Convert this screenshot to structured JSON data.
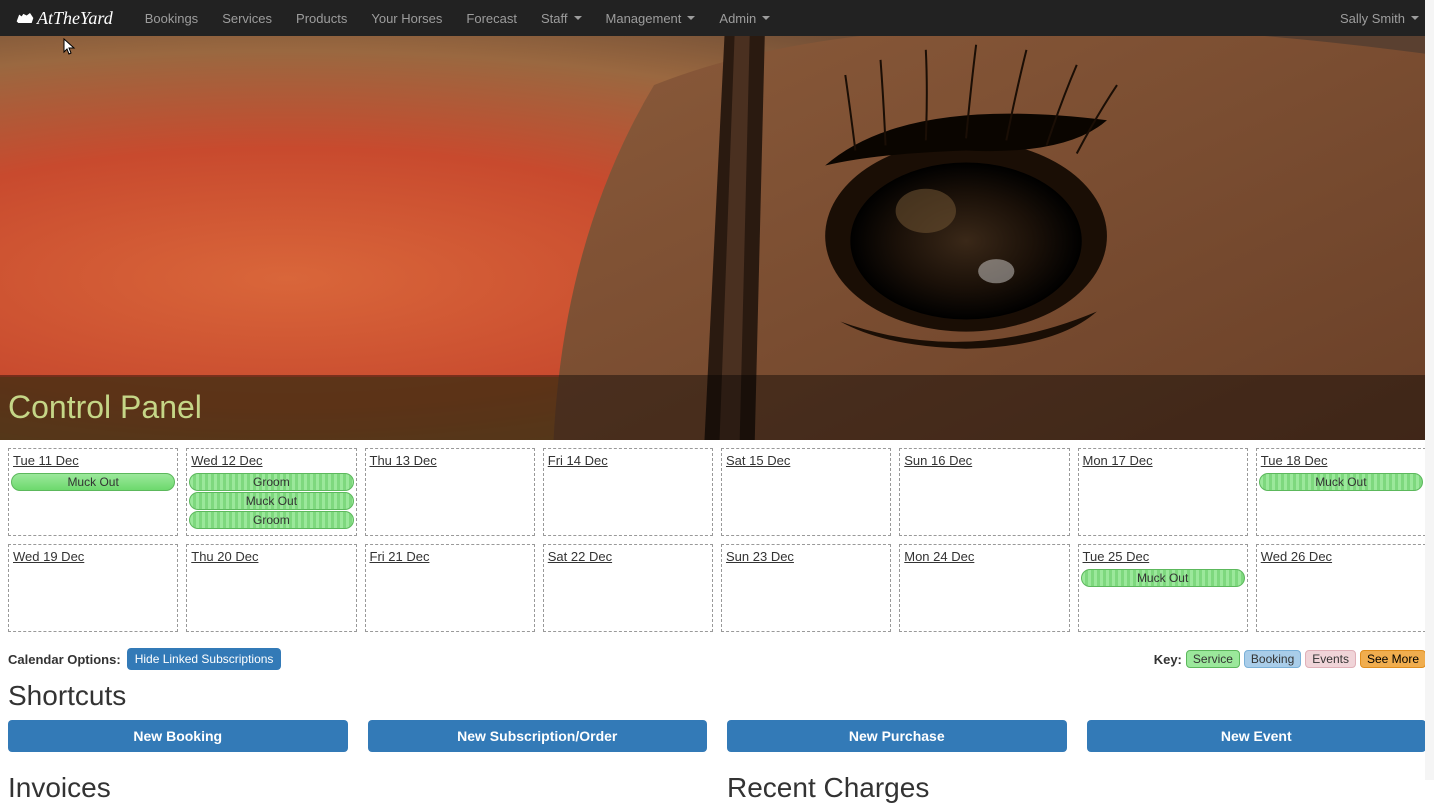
{
  "navbar": {
    "brand": "AtTheYard",
    "items": [
      {
        "label": "Bookings",
        "hasDropdown": false
      },
      {
        "label": "Services",
        "hasDropdown": false
      },
      {
        "label": "Products",
        "hasDropdown": false
      },
      {
        "label": "Your Horses",
        "hasDropdown": false
      },
      {
        "label": "Forecast",
        "hasDropdown": false
      },
      {
        "label": "Staff",
        "hasDropdown": true
      },
      {
        "label": "Management",
        "hasDropdown": true
      },
      {
        "label": "Admin",
        "hasDropdown": true
      }
    ],
    "user": "Sally Smith"
  },
  "hero": {
    "title": "Control Panel"
  },
  "calendar": {
    "days": [
      {
        "label": "Tue 11 Dec",
        "events": [
          {
            "label": "Muck Out",
            "striped": false
          }
        ]
      },
      {
        "label": "Wed 12 Dec",
        "events": [
          {
            "label": "Groom",
            "striped": true
          },
          {
            "label": "Muck Out",
            "striped": true
          },
          {
            "label": "Groom",
            "striped": true
          }
        ]
      },
      {
        "label": "Thu 13 Dec",
        "events": []
      },
      {
        "label": "Fri 14 Dec",
        "events": []
      },
      {
        "label": "Sat 15 Dec",
        "events": []
      },
      {
        "label": "Sun 16 Dec",
        "events": []
      },
      {
        "label": "Mon 17 Dec",
        "events": []
      },
      {
        "label": "Tue 18 Dec",
        "events": [
          {
            "label": "Muck Out",
            "striped": true
          }
        ]
      },
      {
        "label": "Wed 19 Dec",
        "events": []
      },
      {
        "label": "Thu 20 Dec",
        "events": []
      },
      {
        "label": "Fri 21 Dec",
        "events": []
      },
      {
        "label": "Sat 22 Dec",
        "events": []
      },
      {
        "label": "Sun 23 Dec",
        "events": []
      },
      {
        "label": "Mon 24 Dec",
        "events": []
      },
      {
        "label": "Tue 25 Dec",
        "events": [
          {
            "label": "Muck Out",
            "striped": true
          }
        ]
      },
      {
        "label": "Wed 26 Dec",
        "events": []
      }
    ],
    "optionsLabel": "Calendar Options:",
    "hideLinkedLabel": "Hide Linked Subscriptions",
    "keyLabel": "Key:",
    "keys": {
      "service": "Service",
      "booking": "Booking",
      "events": "Events",
      "seemore": "See More"
    }
  },
  "shortcuts": {
    "heading": "Shortcuts",
    "buttons": [
      "New Booking",
      "New Subscription/Order",
      "New Purchase",
      "New Event"
    ]
  },
  "bottom": {
    "left_heading": "Invoices",
    "right_heading": "Recent Charges"
  }
}
